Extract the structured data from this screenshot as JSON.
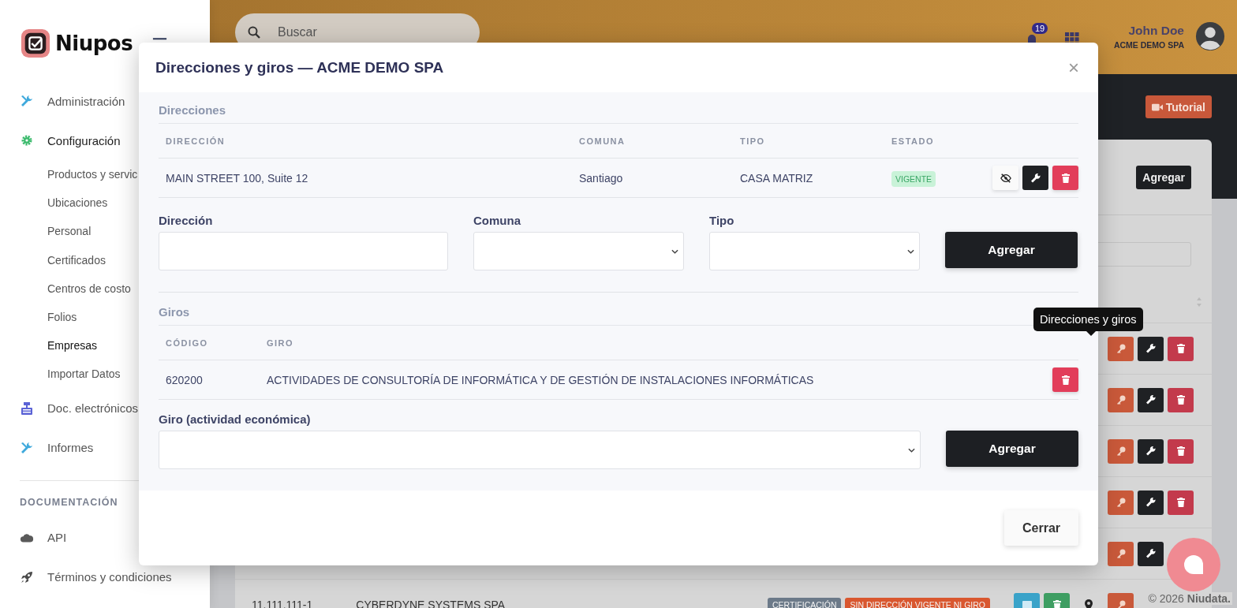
{
  "sidebar": {
    "logo": "Niupos",
    "items": [
      {
        "label": "Administración",
        "kind": "section",
        "expanded": false
      },
      {
        "label": "Configuración",
        "kind": "section",
        "expanded": true,
        "children": [
          {
            "label": "Productos y servic",
            "selected": false
          },
          {
            "label": "Ubicaciones",
            "selected": false
          },
          {
            "label": "Personal",
            "selected": false
          },
          {
            "label": "Certificados",
            "selected": false
          },
          {
            "label": "Centros de costo",
            "selected": false
          },
          {
            "label": "Folios",
            "selected": false
          },
          {
            "label": "Empresas",
            "selected": true
          },
          {
            "label": "Importar Datos",
            "selected": false
          }
        ]
      },
      {
        "label": "Doc. electrónicos",
        "kind": "section",
        "expanded": false
      },
      {
        "label": "Informes",
        "kind": "section",
        "expanded": false
      },
      {
        "label": "DOCUMENTACIÓN",
        "kind": "heading"
      },
      {
        "label": "API",
        "kind": "section",
        "expanded": false
      },
      {
        "label": "Términos y condiciones",
        "kind": "section",
        "expanded": false
      }
    ]
  },
  "topbar": {
    "search": {
      "placeholder": "Buscar"
    },
    "notifications": "19",
    "user": {
      "name": "John Doe",
      "company": "ACME DEMO SPA"
    }
  },
  "page": {
    "tutorial_button": "Tutorial",
    "add_button": "Agregar",
    "rows": [
      {
        "kind": "partial"
      },
      {
        "kind": "partial"
      },
      {
        "kind": "partial"
      },
      {
        "kind": "partial"
      },
      {
        "kind": "partial"
      },
      {
        "kind": "full",
        "rut": "11.111.111-1",
        "name": "CYBERDYNE SYSTEMS SPA",
        "badges": [
          {
            "label": "CERTIFICACIÓN",
            "color": "#6c7a89"
          },
          {
            "label": "SIN DIRECCIÓN VIGENTE NI GIRO",
            "color": "#d9572f"
          }
        ]
      }
    ]
  },
  "tooltip": "Direcciones y giros",
  "footer": "© 2026 **Niudata.**",
  "modal": {
    "title": "Direcciones y giros — ACME DEMO SPA",
    "close": "×",
    "addresses": {
      "heading": "Direcciones",
      "columns": [
        "DIRECCIÓN",
        "COMUNA",
        "TIPO",
        "ESTADO"
      ],
      "rows": [
        {
          "direccion": "MAIN STREET 100, Suite 12",
          "comuna": "Santiago",
          "tipo": "CASA MATRIZ",
          "estado": "VIGENTE"
        }
      ],
      "fields": [
        {
          "label": "Dirección",
          "kind": "text"
        },
        {
          "label": "Comuna",
          "kind": "select"
        },
        {
          "label": "Tipo",
          "kind": "select"
        }
      ],
      "add_button": "Agregar"
    },
    "giros": {
      "heading": "Giros",
      "columns": [
        "CÓDIGO",
        "GIRO"
      ],
      "rows": [
        {
          "codigo": "620200",
          "giro": "ACTIVIDADES DE CONSULTORÍA DE INFORMÁTICA Y DE GESTIÓN DE INSTALACIONES INFORMÁTICAS"
        }
      ],
      "fields": [
        {
          "label": "Giro (actividad económica)",
          "kind": "select"
        }
      ],
      "add_button": "Agregar"
    },
    "close_button": "Cerrar"
  }
}
